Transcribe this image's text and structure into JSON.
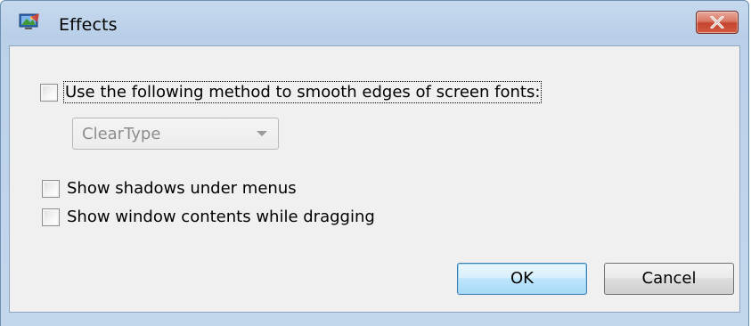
{
  "window": {
    "title": "Effects",
    "icon": "display-settings-icon",
    "close_icon": "close-x-icon"
  },
  "options": {
    "smooth_fonts": {
      "label": "Use the following method to smooth edges of screen fonts:",
      "checked": false
    },
    "smoothing_method": {
      "selected": "ClearType",
      "enabled": false
    },
    "shadows": {
      "label": "Show shadows under menus",
      "checked": false
    },
    "drag_contents": {
      "label": "Show window contents while dragging",
      "checked": false
    }
  },
  "buttons": {
    "ok": "OK",
    "cancel": "Cancel"
  },
  "colors": {
    "titlebar": "#bcd2ea",
    "client": "#f0f0f0",
    "close_button": "#c5442f",
    "default_button_border": "#3c7fb1"
  }
}
